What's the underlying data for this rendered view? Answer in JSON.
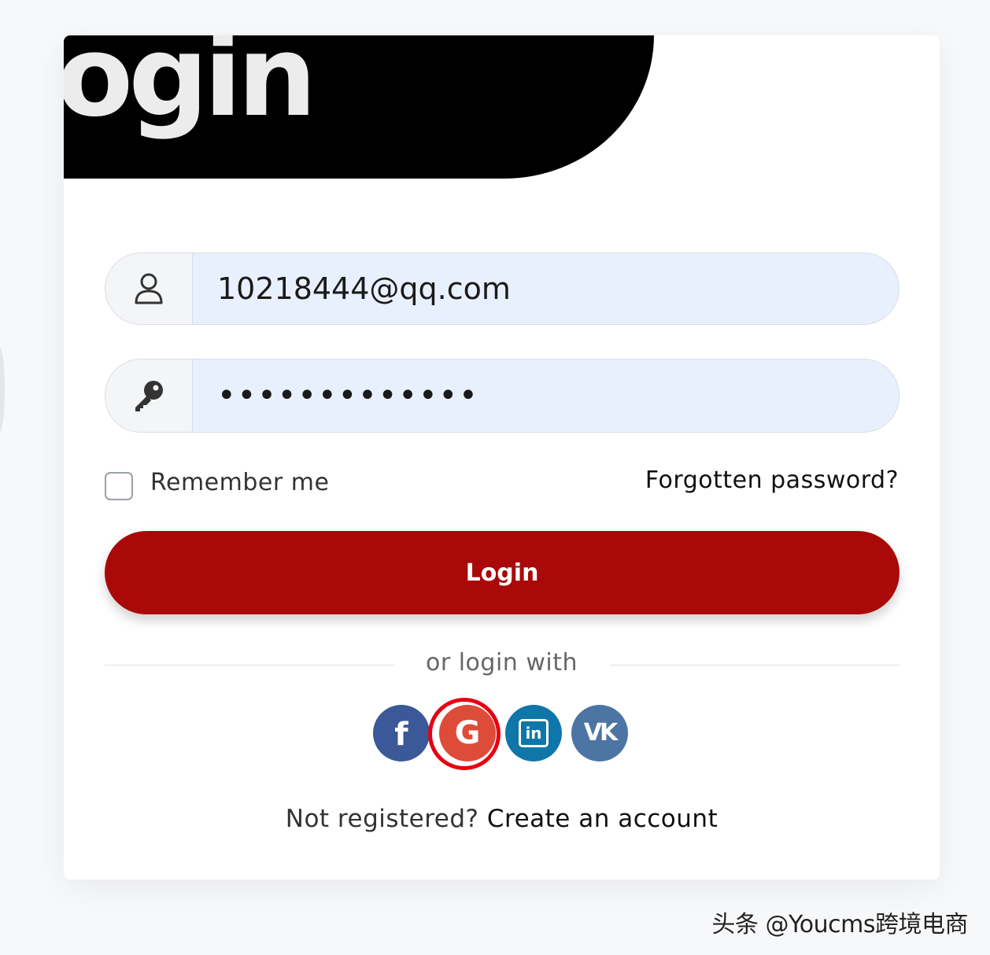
{
  "header": {
    "title": "login"
  },
  "form": {
    "username": {
      "value": "10218444@qq.com",
      "icon": "user-icon"
    },
    "password": {
      "value": "•••••••••••••",
      "icon": "key-icon"
    },
    "remember_label": "Remember me",
    "remember_checked": false,
    "forgot_label": "Forgotten password?",
    "submit_label": "Login"
  },
  "social": {
    "divider_label": "or login with",
    "providers": [
      {
        "name": "facebook",
        "glyph": "f",
        "color": "#3b5998"
      },
      {
        "name": "google",
        "glyph": "G",
        "color": "#dd4b39",
        "highlighted": true
      },
      {
        "name": "linkedin",
        "glyph": "in",
        "color": "#0e76a8"
      },
      {
        "name": "vk",
        "glyph": "vk",
        "color": "#4c75a3"
      }
    ]
  },
  "register": {
    "prompt": "Not registered?",
    "link_label": "Create an account"
  },
  "watermark": "头条 @Youcms跨境电商",
  "colors": {
    "accent": "#aa0909",
    "banner": "#000000",
    "input_bg": "#e8f0fe",
    "highlight": "#e60012"
  }
}
